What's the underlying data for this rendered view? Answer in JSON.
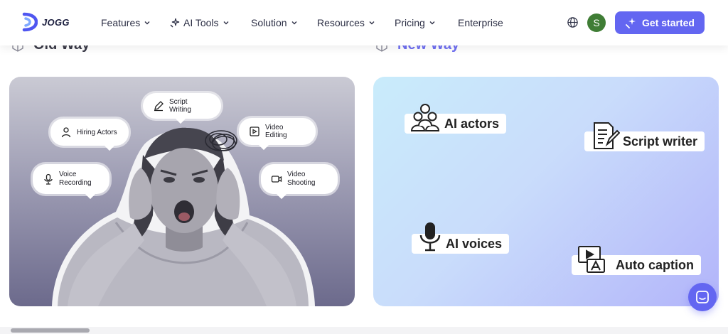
{
  "nav": {
    "brand": "JOGG",
    "items": [
      {
        "label": "Features",
        "icon": "chevron-down-icon"
      },
      {
        "label": "AI Tools",
        "icon": "sparkle-icon"
      },
      {
        "label": "Solution",
        "icon": "chevron-down-icon"
      },
      {
        "label": "Resources",
        "icon": "chevron-down-icon"
      },
      {
        "label": "Pricing",
        "icon": "chevron-down-icon"
      },
      {
        "label": "Enterprise"
      }
    ],
    "avatar_initial": "S",
    "cta_label": "Get started",
    "accent_color": "#6366f1",
    "avatar_color": "#3f7d35"
  },
  "old_way": {
    "heading": "Old Way",
    "bubbles": [
      "Script Writing",
      "Hiring Actors",
      "Video Editing",
      "Voice\nRecording",
      "Video\nShooting"
    ]
  },
  "new_way": {
    "heading": "New Way",
    "heading_color": "#6f6ff2",
    "tags": [
      "AI actors",
      "Script writer",
      "AI voices",
      "Auto caption"
    ]
  },
  "scrollbar": {
    "position": 0.01
  }
}
